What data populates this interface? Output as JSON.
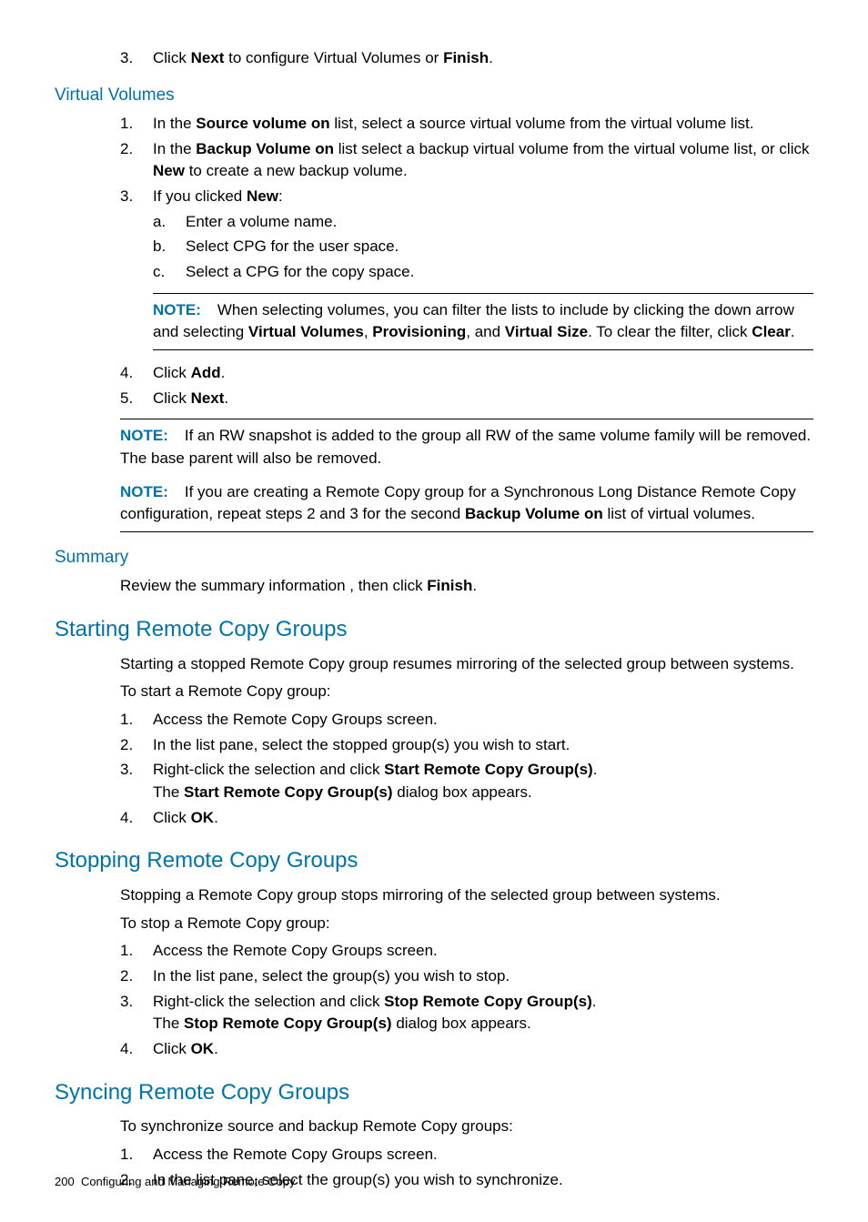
{
  "intro_step_num": "3.",
  "intro_step_pre": "Click ",
  "intro_step_b1": "Next",
  "intro_step_mid": " to configure Virtual Volumes or ",
  "intro_step_b2": "Finish",
  "intro_step_post": ".",
  "vv_heading": "Virtual Volumes",
  "vv_li1_num": "1.",
  "vv_li1_pre": "In the ",
  "vv_li1_b1": "Source volume on",
  "vv_li1_post": " list, select a source virtual volume from the virtual volume list.",
  "vv_li2_num": "2.",
  "vv_li2_pre": "In the ",
  "vv_li2_b1": "Backup Volume on",
  "vv_li2_mid": " list select a backup virtual volume from the virtual volume list, or click ",
  "vv_li2_b2": "New",
  "vv_li2_post": " to create a new backup volume.",
  "vv_li3_num": "3.",
  "vv_li3_pre": "If you clicked ",
  "vv_li3_b1": "New",
  "vv_li3_post": ":",
  "vv_li3a_num": "a.",
  "vv_li3a": "Enter a volume name.",
  "vv_li3b_num": "b.",
  "vv_li3b": "Select CPG for the user space.",
  "vv_li3c_num": "c.",
  "vv_li3c": "Select a CPG for the copy space.",
  "note1_label": "NOTE:",
  "note1_pre": "When selecting volumes, you can filter the lists to include by clicking the down arrow and selecting ",
  "note1_b1": "Virtual Volumes",
  "note1_sep1": ", ",
  "note1_b2": "Provisioning",
  "note1_sep2": ", and ",
  "note1_b3": "Virtual Size",
  "note1_mid": ". To clear the filter, click ",
  "note1_b4": "Clear",
  "note1_post": ".",
  "vv_li4_num": "4.",
  "vv_li4_pre": "Click ",
  "vv_li4_b1": "Add",
  "vv_li4_post": ".",
  "vv_li5_num": "5.",
  "vv_li5_pre": "Click ",
  "vv_li5_b1": "Next",
  "vv_li5_post": ".",
  "note2_label": "NOTE:",
  "note2_text": "If an RW snapshot is added to the group all RW of the same volume family will be removed. The base parent will also be removed.",
  "note3_label": "NOTE:",
  "note3_pre": "If you are creating a Remote Copy group for a Synchronous Long Distance Remote Copy configuration, repeat steps 2 and 3 for the second ",
  "note3_b1": "Backup Volume on",
  "note3_post": " list of virtual volumes.",
  "summary_heading": "Summary",
  "summary_pre": "Review the summary information , then click ",
  "summary_b1": "Finish",
  "summary_post": ".",
  "start_heading": "Starting Remote Copy Groups",
  "start_p1": "Starting a stopped Remote Copy group resumes mirroring of the selected group between systems.",
  "start_p2": "To start a Remote Copy group:",
  "start_li1_num": "1.",
  "start_li1": "Access the Remote Copy Groups screen.",
  "start_li2_num": "2.",
  "start_li2": "In the list pane, select the stopped group(s) you wish to start.",
  "start_li3_num": "3.",
  "start_li3_pre": "Right-click the selection and click ",
  "start_li3_b1": "Start Remote Copy Group(s)",
  "start_li3_post": ".",
  "start_li3_line2_pre": "The ",
  "start_li3_line2_b1": "Start Remote Copy Group(s)",
  "start_li3_line2_post": " dialog box appears.",
  "start_li4_num": "4.",
  "start_li4_pre": "Click ",
  "start_li4_b1": "OK",
  "start_li4_post": ".",
  "stop_heading": "Stopping Remote Copy Groups",
  "stop_p1": "Stopping a Remote Copy group stops mirroring of the selected group between systems.",
  "stop_p2": "To stop a Remote Copy group:",
  "stop_li1_num": "1.",
  "stop_li1": "Access the Remote Copy Groups screen.",
  "stop_li2_num": "2.",
  "stop_li2": "In the list pane, select the group(s) you wish to stop.",
  "stop_li3_num": "3.",
  "stop_li3_pre": "Right-click the selection and click ",
  "stop_li3_b1": "Stop Remote Copy Group(s)",
  "stop_li3_post": ".",
  "stop_li3_line2_pre": "The ",
  "stop_li3_line2_b1": "Stop Remote Copy Group(s)",
  "stop_li3_line2_post": " dialog box appears.",
  "stop_li4_num": "4.",
  "stop_li4_pre": "Click ",
  "stop_li4_b1": "OK",
  "stop_li4_post": ".",
  "sync_heading": "Syncing Remote Copy Groups",
  "sync_p1": "To synchronize source and backup Remote Copy groups:",
  "sync_li1_num": "1.",
  "sync_li1": "Access the Remote Copy Groups screen.",
  "sync_li2_num": "2.",
  "sync_li2": "In the list pane, select the group(s) you wish to synchronize.",
  "footer_page": "200",
  "footer_text": "Configuring and Managing Remote Copy"
}
